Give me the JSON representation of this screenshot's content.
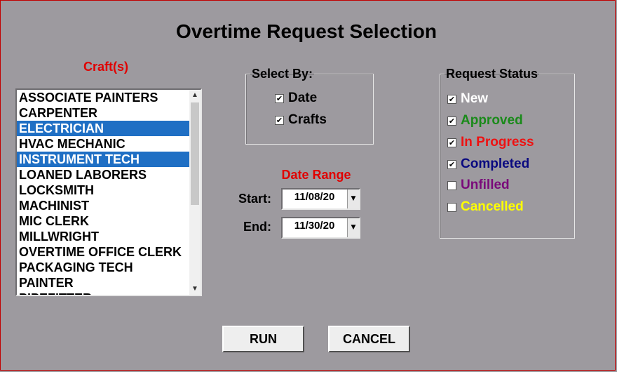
{
  "window": {
    "title": "Overtime Request Selection"
  },
  "crafts": {
    "label": "Craft(s)",
    "items": [
      {
        "label": "ASSOCIATE PAINTERS",
        "selected": false
      },
      {
        "label": "CARPENTER",
        "selected": false
      },
      {
        "label": "ELECTRICIAN",
        "selected": true
      },
      {
        "label": "HVAC MECHANIC",
        "selected": false
      },
      {
        "label": "INSTRUMENT TECH",
        "selected": true
      },
      {
        "label": "LOANED LABORERS",
        "selected": false
      },
      {
        "label": "LOCKSMITH",
        "selected": false
      },
      {
        "label": "MACHINIST",
        "selected": false
      },
      {
        "label": "MIC CLERK",
        "selected": false
      },
      {
        "label": "MILLWRIGHT",
        "selected": false
      },
      {
        "label": "OVERTIME OFFICE CLERK",
        "selected": false
      },
      {
        "label": "PACKAGING TECH",
        "selected": false
      },
      {
        "label": "PAINTER",
        "selected": false
      },
      {
        "label": "PIPEFITTER",
        "selected": false
      }
    ]
  },
  "select_by": {
    "legend": "Select By:",
    "options": [
      {
        "label": "Date",
        "checked": true
      },
      {
        "label": "Crafts",
        "checked": true
      }
    ]
  },
  "request_status": {
    "legend": "Request Status",
    "options": [
      {
        "label": "New",
        "checked": true,
        "color": "#ffffff"
      },
      {
        "label": "Approved",
        "checked": true,
        "color": "#1a8a1a"
      },
      {
        "label": "In Progress",
        "checked": true,
        "color": "#ee1111"
      },
      {
        "label": "Completed",
        "checked": true,
        "color": "#0a0a80"
      },
      {
        "label": "Unfilled",
        "checked": false,
        "color": "#7a0a7a"
      },
      {
        "label": "Cancelled",
        "checked": false,
        "color": "#ffff00"
      }
    ]
  },
  "date_range": {
    "label": "Date Range",
    "start_label": "Start:",
    "start_value": "11/08/20",
    "end_label": "End:",
    "end_value": "11/30/20"
  },
  "buttons": {
    "run": "RUN",
    "cancel": "CANCEL"
  },
  "colors": {
    "background": "#9d9a9f",
    "accent_red": "#e00000",
    "selection": "#1f6fc4"
  }
}
